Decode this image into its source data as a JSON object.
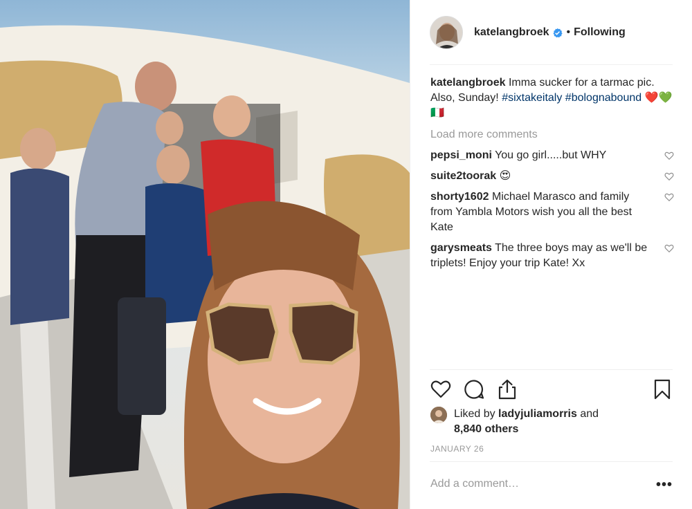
{
  "post": {
    "username": "katelangbroek",
    "follow_separator": "•",
    "follow_status": "Following",
    "caption_user": "katelangbroek",
    "caption_text": "Imma sucker for a tarmac pic. Also, Sunday!",
    "caption_tag1": "#sixtakeitaly",
    "caption_tag2": "#bolognabound",
    "caption_emojis": "❤️💚🇮🇹",
    "load_more": "Load more comments",
    "comments": [
      {
        "user": "pepsi_moni",
        "text": "You go girl.....but WHY"
      },
      {
        "user": "suite2toorak",
        "text": "😍"
      },
      {
        "user": "shorty1602",
        "text": "Michael Marasco and family from Yambla Motors wish you all the best Kate"
      },
      {
        "user": "garysmeats",
        "text": "The three boys may as we'll be triplets! Enjoy your trip Kate! Xx"
      }
    ],
    "liked_by_prefix": "Liked by",
    "liked_by_user": "ladyjuliamorris",
    "liked_by_and": "and",
    "liked_by_count": "8,840 others",
    "date": "JANUARY 26",
    "add_comment_placeholder": "Add a comment…",
    "more_options": "•••"
  },
  "icons": {
    "verified": "verified-badge-icon",
    "like": "heart-icon",
    "comment": "comment-bubble-icon",
    "share": "share-icon",
    "save": "bookmark-icon"
  },
  "colors": {
    "text": "#262626",
    "muted": "#999999",
    "hashtag": "#003569",
    "verified": "#3897f0"
  }
}
